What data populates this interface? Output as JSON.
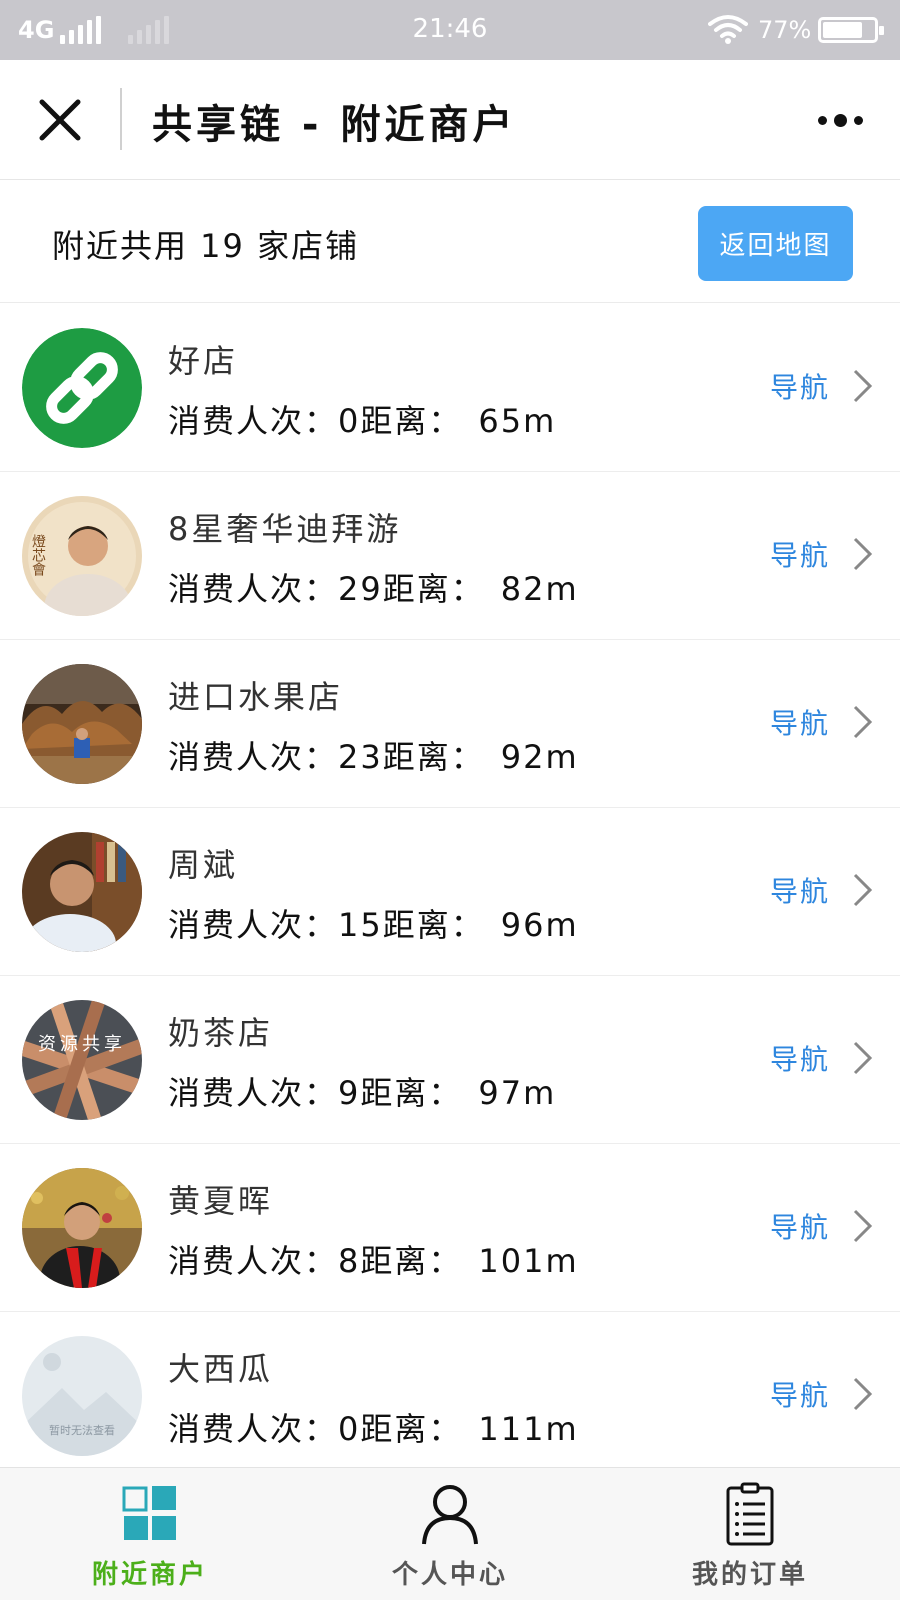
{
  "status_bar": {
    "network": "4G",
    "time": "21:46",
    "battery_percent": "77%",
    "battery_level": 0.77
  },
  "header": {
    "title": "共享链 - 附近商户"
  },
  "summary": {
    "text": "附近共用 19 家店铺",
    "button_label": "返回地图",
    "button_color": "#4ca7f4"
  },
  "labels": {
    "consume_prefix": "消费人次：",
    "distance_prefix": "距离：",
    "nav": "导航"
  },
  "shops": [
    {
      "name": "好店",
      "visits": "0",
      "distance": "65m",
      "avatar": "chain-link-logo"
    },
    {
      "name": "8星奢华迪拜游",
      "visits": "29",
      "distance": "82m",
      "avatar": "man-portrait"
    },
    {
      "name": "进口水果店",
      "visits": "23",
      "distance": "92m",
      "avatar": "wood-carving-photo"
    },
    {
      "name": "周斌",
      "visits": "15",
      "distance": "96m",
      "avatar": "man-bookshelf-photo"
    },
    {
      "name": "奶茶店",
      "visits": "9",
      "distance": "97m",
      "avatar": "hands-resource-share"
    },
    {
      "name": "黄夏晖",
      "visits": "8",
      "distance": "101m",
      "avatar": "man-red-scarf-photo"
    },
    {
      "name": "大西瓜",
      "visits": "0",
      "distance": "111m",
      "avatar": "image-unavailable-placeholder"
    }
  ],
  "avatar_texts": {
    "portrait_badge": "燈芯會",
    "hands_text": "资源共享",
    "placeholder_text": "暂时无法查看"
  },
  "tab_bar": {
    "tabs": [
      {
        "label": "附近商户",
        "icon": "grid-icon",
        "active": true
      },
      {
        "label": "个人中心",
        "icon": "person-icon",
        "active": false
      },
      {
        "label": "我的订单",
        "icon": "clipboard-icon",
        "active": false
      }
    ],
    "active_color": "#4caf1a"
  }
}
